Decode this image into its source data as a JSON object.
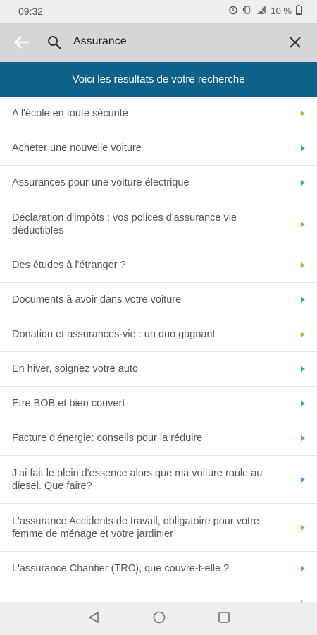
{
  "status_bar": {
    "time": "09:32",
    "battery_text": "10 %",
    "icons": [
      "alarm-icon",
      "vibrate-icon",
      "signal-icon",
      "battery-icon"
    ]
  },
  "search": {
    "query": "Assurance"
  },
  "banner": {
    "text": "Voici les résultats de votre recherche"
  },
  "results": [
    {
      "label": "A l'école en toute sécurité",
      "arrow_color": "#e09a2a"
    },
    {
      "label": "Acheter une nouvelle voiture",
      "arrow_color": "#2ba7d6"
    },
    {
      "label": "Assurances pour une voiture électrique",
      "arrow_color": "#2ba7d6"
    },
    {
      "label": "Déclaration d'impôts : vos polices d'assurance vie déductibles",
      "arrow_color": "#e09a2a"
    },
    {
      "label": "Des études à l'étranger ?",
      "arrow_color": "#e09a2a"
    },
    {
      "label": "Documents à avoir dans votre voiture",
      "arrow_color": "#2ba7d6"
    },
    {
      "label": "Donation et assurances-vie : un duo gagnant",
      "arrow_color": "#e09a2a"
    },
    {
      "label": "En hiver, soignez votre auto",
      "arrow_color": "#2ba7d6"
    },
    {
      "label": "Etre BOB et bien couvert",
      "arrow_color": "#2ba7d6"
    },
    {
      "label": "Facture d'énergie: conseils pour la réduire",
      "arrow_color": "#5cb85c"
    },
    {
      "label": "J'ai fait le plein d'essence alors que ma voiture roule au diesel. Que faire?",
      "arrow_color": "#2ba7d6"
    },
    {
      "label": "L'assurance Accidents de travail, obligatoire pour votre femme de ménage et votre jardinier",
      "arrow_color": "#e09a2a"
    },
    {
      "label": "L'assurance Chantier (TRC), que couvre-t-elle ?",
      "arrow_color": "#5cb85c"
    },
    {
      "label": "",
      "arrow_color": "#2ba7d6"
    }
  ],
  "nav": {
    "buttons": [
      "back-triangle-icon",
      "home-circle-icon",
      "recents-square-icon"
    ]
  }
}
